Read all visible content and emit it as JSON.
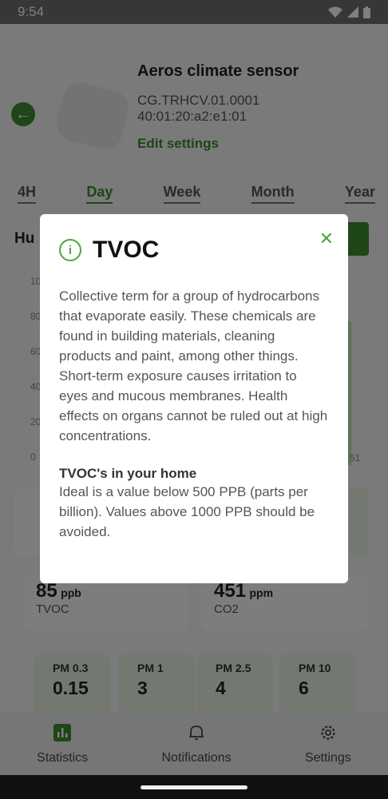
{
  "status": {
    "time": "9:54"
  },
  "device": {
    "title": "Aeros climate sensor",
    "id_line1": "CG.TRHCV.01.0001",
    "id_line2": "40:01:20:a2:e1:01",
    "edit_label": "Edit settings"
  },
  "tabs": [
    "4H",
    "Day",
    "Week",
    "Month",
    "Year"
  ],
  "chart": {
    "title_partial": "Hu",
    "y_ticks": [
      "10",
      "80",
      "60",
      "40",
      "20",
      "0"
    ],
    "x_tick_partial": "51"
  },
  "metrics": [
    {
      "value": "85",
      "unit": "ppb",
      "label": "TVOC"
    },
    {
      "value": "451",
      "unit": "ppm",
      "label": "CO2"
    }
  ],
  "pm": [
    {
      "label": "PM 0.3",
      "value": "0.15"
    },
    {
      "label": "PM 1",
      "value": "3"
    },
    {
      "label": "PM 2.5",
      "value": "4"
    },
    {
      "label": "PM 10",
      "value": "6"
    }
  ],
  "nav": [
    {
      "label": "Statistics",
      "icon": "chart-icon"
    },
    {
      "label": "Notifications",
      "icon": "bell-icon"
    },
    {
      "label": "Settings",
      "icon": "gear-icon"
    }
  ],
  "dialog": {
    "title": "TVOC",
    "body": "Collective term for a group of hydrocarbons that evaporate easily. These chemicals are found in building materials, cleaning products and paint, among other things. Short-term exposure causes irritation to eyes and mucous membranes. Health effects on organs cannot be ruled out at high concentrations.",
    "subtitle": "TVOC's in your home",
    "body2": "Ideal is a value below 500 PPB (parts per billion). Values above 1000 PPB should be avoided."
  },
  "colors": {
    "accent": "#3d8d2e"
  }
}
